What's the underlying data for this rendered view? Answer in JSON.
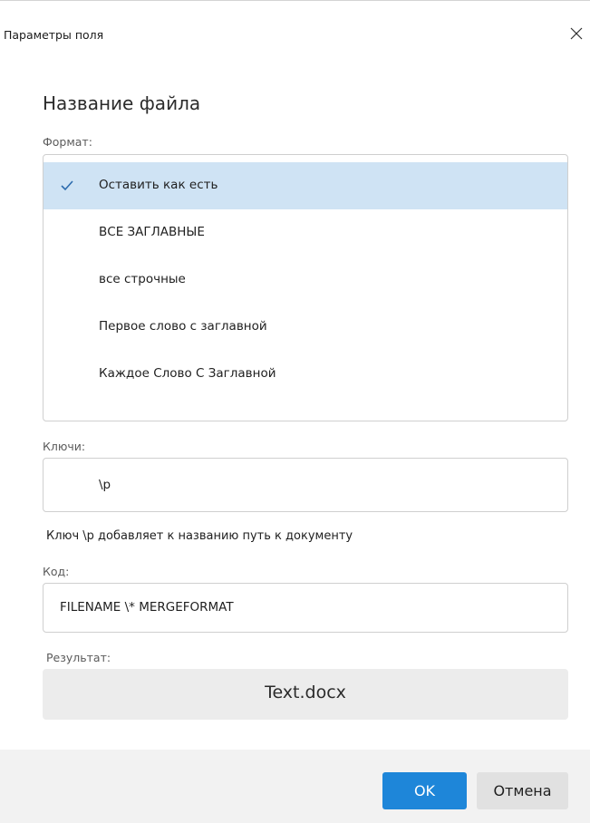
{
  "window": {
    "title": "Параметры поля"
  },
  "heading": "Название файла",
  "format": {
    "label": "Формат:",
    "options": [
      {
        "label": "Оставить как есть",
        "selected": true
      },
      {
        "label": "ВСЕ ЗАГЛАВНЫЕ",
        "selected": false
      },
      {
        "label": "все строчные",
        "selected": false
      },
      {
        "label": "Первое слово с заглавной",
        "selected": false
      },
      {
        "label": "Каждое Слово С Заглавной",
        "selected": false
      }
    ]
  },
  "keys": {
    "label": "Ключи:",
    "value": "\\p",
    "hint": "Ключ \\p добавляет к названию путь к документу"
  },
  "code": {
    "label": "Код:",
    "value": "FILENAME \\* MERGEFORMAT"
  },
  "result": {
    "label": "Результат:",
    "value": "Text.docx"
  },
  "buttons": {
    "ok": "OK",
    "cancel": "Отмена"
  },
  "colors": {
    "accent": "#1e86d9",
    "selection": "#cfe3f4",
    "checkmark": "#2d6cae"
  },
  "icons": {
    "close": "close-icon",
    "check": "checkmark-icon"
  }
}
